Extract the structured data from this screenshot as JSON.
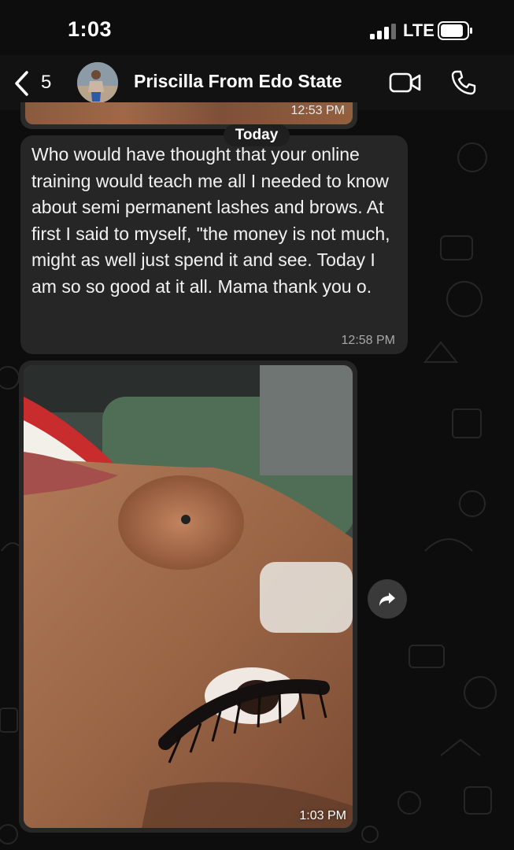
{
  "status_bar": {
    "time": "1:03",
    "network": "LTE"
  },
  "header": {
    "back_count": "5",
    "contact_name": "Priscilla From Edo State"
  },
  "messages": {
    "prev_image_time": "12:53 PM",
    "date_chip": "Today",
    "text_message": {
      "text": "Who would have thought that your online training would teach me all I needed to know about semi permanent lashes and brows. At first I said to myself, \"the money is not much, might as well just spend it and see. Today I am so so good at it all. Mama thank you o.",
      "time": "12:58 PM"
    },
    "image_message": {
      "time": "1:03 PM"
    }
  },
  "icons": {
    "back": "chevron-left-icon",
    "video": "video-camera-icon",
    "call": "phone-icon",
    "forward": "forward-arrow-icon"
  },
  "colors": {
    "background": "#0d0d0d",
    "bubble": "#262626",
    "text": "#f2f2f2"
  }
}
